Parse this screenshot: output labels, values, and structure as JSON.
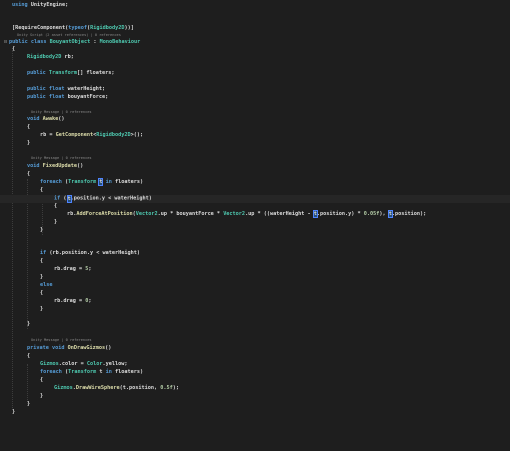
{
  "editor": {
    "lenses": {
      "bouyant_class": "Unity Script (2 asset references) | 0 references",
      "awake": "Unity Message | 0 references",
      "fixed_update": "Unity Message | 0 references",
      "gizmos": "Unity Message | 0 references"
    },
    "lines": {
      "l1_using": "using",
      "l1_ns": "UnityEngine;",
      "l3_open": "[RequireComponent(",
      "l3_typeof": "typeof",
      "l3_paren": "(",
      "l3_type": "Rigidbody2D",
      "l3_close": "))]",
      "l4_public": "public",
      "l4_class": "class",
      "l4_name": "BouyantObject",
      "l4_colon": " : ",
      "l4_base": "MonoBehaviour",
      "l5": "{",
      "l6_type": "Rigidbody2D",
      "l6_rest": " rb;",
      "l8_public": "public",
      "l8_type": "Transform",
      "l8_rest": "[] floaters;",
      "l10_public": "public",
      "l10_float": "float",
      "l10_rest": " waterHeight;",
      "l11_public": "public",
      "l11_float": "float",
      "l11_rest": " bouyantForce;",
      "l13_void": "void",
      "l13_name": "Awake",
      "l13_rest": "()",
      "l14": "{",
      "l15_a": "rb = ",
      "l15_fn": "GetComponent",
      "l15_lt": "<",
      "l15_type": "Rigidbody2D",
      "l15_rest": ">();",
      "l16": "}",
      "l18_void": "void",
      "l18_name": "FixedUpdate",
      "l18_rest": "()",
      "l19": "{",
      "l20_foreach": "foreach",
      "l20_open": " (",
      "l20_type": "Transform",
      "l20_t": "t",
      "l20_in": "in",
      "l20_rest": " floaters)",
      "l21": "{",
      "l22_if": "if",
      "l22_open": " (",
      "l22_t": "t",
      "l22_rest": ".position.y < waterHeight)",
      "l23": "{",
      "l24_a": "rb.",
      "l24_fn": "AddForceAtPosition",
      "l24_b": "(",
      "l24_vec1": "Vector2",
      "l24_c": ".up * bouyantForce * ",
      "l24_vec2": "Vector2",
      "l24_d": ".up * ((waterHeight - ",
      "l24_t1": "t",
      "l24_e": ".position.y) * ",
      "l24_num": "0.05f",
      "l24_f": "), ",
      "l24_t2": "t",
      "l24_g": ".position);",
      "l25": "}",
      "l26": "}",
      "l28_if": "if",
      "l28_rest": " (rb.position.y < waterHeight)",
      "l29": "{",
      "l30_a": "rb.drag = ",
      "l30_num": "5",
      "l30_b": ";",
      "l31": "}",
      "l32_else": "else",
      "l33": "{",
      "l34_a": "rb.drag = ",
      "l34_num": "0",
      "l34_b": ";",
      "l35": "}",
      "l37": "}",
      "l39_private": "private",
      "l39_void": "void",
      "l39_name": "OnDrawGizmos",
      "l39_rest": "()",
      "l40": "{",
      "l41_type1": "Gizmos",
      "l41_a": ".color = ",
      "l41_type2": "Color",
      "l41_b": ".yellow;",
      "l42_foreach": "foreach",
      "l42_open": " (",
      "l42_type": "Transform",
      "l42_t": " t ",
      "l42_in": "in",
      "l42_rest": " floaters)",
      "l43": "{",
      "l44_type": "Gizmos",
      "l44_dot": ".",
      "l44_fn": "DrawWireSphere",
      "l44_a": "(t.position, ",
      "l44_num": "0.5f",
      "l44_b": ");",
      "l45": "}",
      "l46": "}",
      "l47": "}"
    }
  },
  "colors": {
    "background": "#1e1e1e",
    "keyword": "#569cd6",
    "type": "#4ec9b0",
    "method": "#dcdcaa",
    "number": "#b5cea8",
    "highlight": "#264f78"
  }
}
